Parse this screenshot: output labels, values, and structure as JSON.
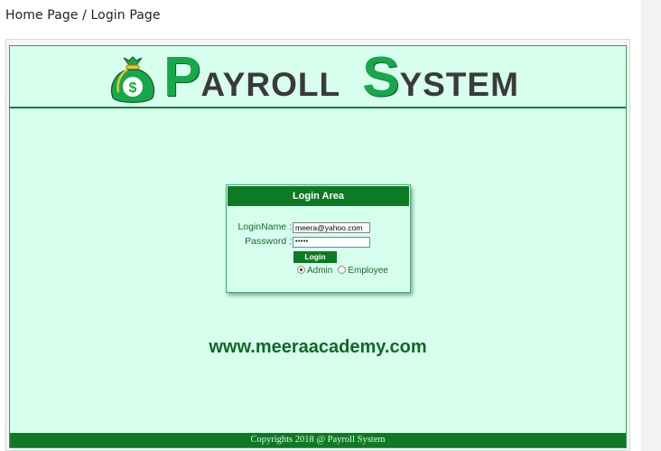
{
  "breadcrumb": "Home Page / Login Page",
  "banner": {
    "title_first_initial": "P",
    "title_first_rest": "AYROLL",
    "title_second_initial": "S",
    "title_second_rest": "YSTEM",
    "bag_symbol": "$",
    "logo_icon": "money-bag-icon"
  },
  "login": {
    "header": "Login Area",
    "loginname_label": "LoginName :",
    "password_label": "Password :",
    "loginname_value": "meera@yahoo.com",
    "password_value": "•••••",
    "login_button": "Login",
    "role_admin": "Admin",
    "role_employee": "Employee",
    "selected_role": "Admin"
  },
  "website": "www.meeraacademy.com",
  "footer": "Copyrights 2018 @ Payroll System",
  "colors": {
    "page_bg": "#d7ffee",
    "dark_green": "#0e7a23",
    "title_green": "#17a84a",
    "title_grey": "#3a3a3a"
  }
}
